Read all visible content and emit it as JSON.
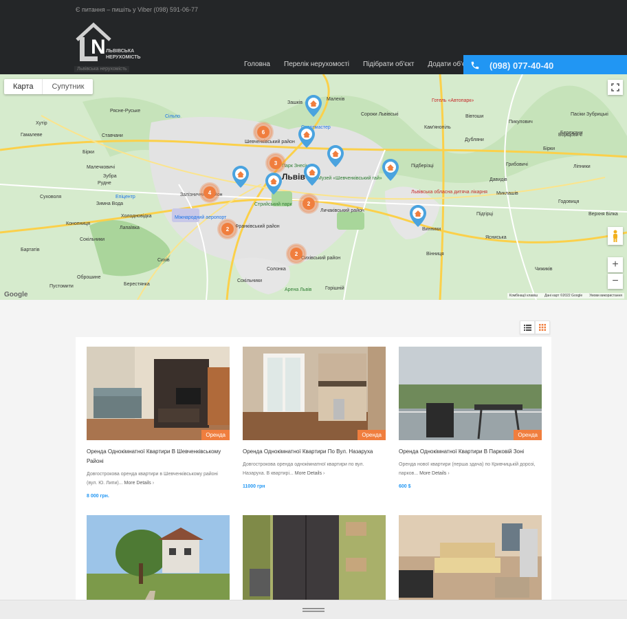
{
  "header": {
    "contact_note": "Є питання – пишіть у Viber (098) 591-06-77",
    "logo_letters": "LN",
    "logo_text_1": "ЛЬВІВСЬКА",
    "logo_text_2": "НЕРУХОМІСТЬ",
    "logo_sub": "Львівська нерухомість",
    "nav": [
      "Головна",
      "Перелік нерухомості",
      "Підібрати об'єкт",
      "Додати об'єкт"
    ],
    "phone": "(098) 077-40-40",
    "bg_color": "#242628",
    "accent_color": "#2196f3"
  },
  "map": {
    "tabs": [
      "Карта",
      "Супутник"
    ],
    "city_label": "Львів",
    "labels": [
      "Малехів",
      "Сороки Львівські",
      "Зашків",
      "Підберізці",
      "Рясне-Руське",
      "Сільпо",
      "Кам'янопіль",
      "Вівтоши",
      "Пасіки Зубрицькі",
      "Пикулович",
      "Бережани",
      "Бірки",
      "Ліпники",
      "Давидів",
      "Винники",
      "Підгірці",
      "Миклашів",
      "Сокільники",
      "Солонка",
      "Горішній",
      "Берестянка",
      "Вінниця",
      "Сихів",
      "Зимна Вода",
      "Холодновідка",
      "Конопниця",
      "Лапаївка",
      "Бартатів",
      "Зубра",
      "Рудне",
      "Суховоля",
      "Оброшине",
      "Бірки",
      "Пустомити",
      "Ставчани",
      "Сокільники",
      "Гамалеве",
      "Хутір",
      "Годовиця",
      "Чижиків",
      "Верхня Білка",
      "Борщовичі",
      "Дубляни",
      "Грибовичі",
      "Ясниська",
      "Малечковичі",
      "Шевченківський район",
      "Залізничний район",
      "Франківський район",
      "Личаківський район",
      "Сихівський район",
      "Стрийський парк",
      "Арена Львів",
      "Музей «Шевченківський гай»",
      "Готель «Автопарк»",
      "Парк Знесіння",
      "Міжнародний аеропорт",
      "Львівська обласна дитяча лікарня",
      "Спортмастер",
      "Епіцентр"
    ],
    "clusters": [
      6,
      3,
      4,
      2,
      2,
      2
    ],
    "pins": 8,
    "footer": [
      "Комбінації клавіш",
      "Дані карт ©2022 Google",
      "Умови використання"
    ],
    "google": "Google"
  },
  "listings": [
    {
      "title": "Оренда Однокімнатної Квартири В Шевченківському Районі",
      "desc": "Довгострокова оренда квартири в Шевченківському районі (вул. Ю. Липи)...",
      "more": "More Details",
      "price": "8 000 грн.",
      "badge": "Оренда"
    },
    {
      "title": "Оренда Однокімнатної Квартири По Вул. Назаруха",
      "desc": "Довгострокова оренда однокімнатної квартири по вул. Назаруха. В квартирі...",
      "more": "More Details",
      "price": "11000 грн",
      "badge": "Оренда"
    },
    {
      "title": "Оренда Однокімнатної Квартири В Парковій Зоні",
      "desc": "Оренда нової квартири (перша здача) по Кривчицькій дорозі, парков...",
      "more": "More Details",
      "price": "600 $",
      "badge": "Оренда"
    },
    {
      "title": "",
      "desc": "",
      "more": "",
      "price": "",
      "badge": ""
    },
    {
      "title": "",
      "desc": "",
      "more": "",
      "price": "",
      "badge": ""
    },
    {
      "title": "",
      "desc": "",
      "more": "",
      "price": "",
      "badge": ""
    }
  ]
}
